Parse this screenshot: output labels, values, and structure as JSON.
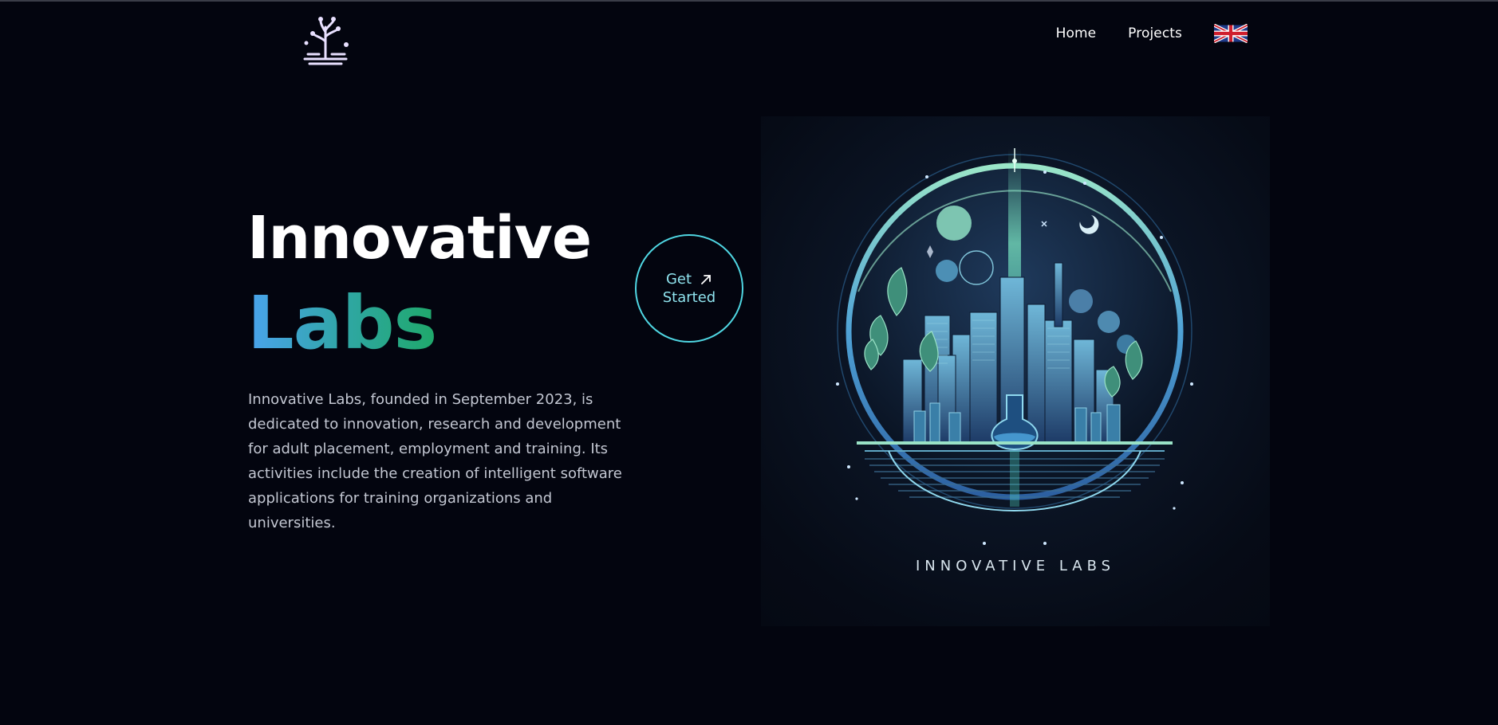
{
  "header": {
    "logo_icon": "plant-circuit-logo-icon",
    "nav": [
      {
        "label": "Home"
      },
      {
        "label": "Projects"
      }
    ],
    "language_icon": "uk-flag-icon"
  },
  "hero": {
    "title_line1": "Innovative",
    "title_line2": "Labs",
    "description": "Innovative Labs, founded in September 2023, is dedicated to innovation, research and development for adult placement, employment and training. Its activities include the creation of intelligent software applications for training organizations and universities.",
    "cta_line1": "Get",
    "cta_line2": "Started",
    "cta_icon": "arrow-up-right-icon"
  },
  "artwork": {
    "label": "INNOVATIVE LABS"
  },
  "colors": {
    "background": "#03050f",
    "accent_cyan": "#4fd6e2",
    "gradient_start": "#4aa3ee",
    "gradient_end": "#1fa86a"
  }
}
